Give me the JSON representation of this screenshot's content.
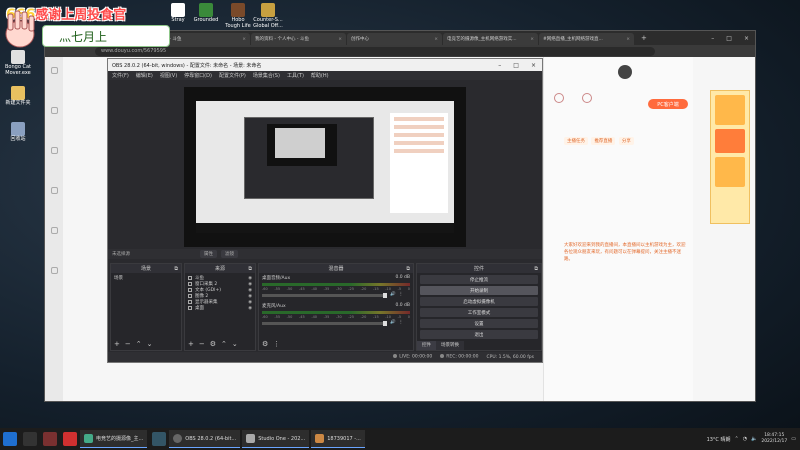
{
  "overlay": {
    "num": "666",
    "thanks": "感谢上周投食官",
    "name": "灬七月上"
  },
  "desktop_icons": [
    {
      "label": "Stray",
      "color": "#ffffff"
    },
    {
      "label": "Grounded",
      "color": "#3a8a3a"
    },
    {
      "label": "Hobo\nTough Life",
      "color": "#7a4a2a"
    },
    {
      "label": "Counter-S...\nGlobal Off...",
      "color": "#c8a040"
    }
  ],
  "left_icons": [
    {
      "label": "Bongo Cat\nMover.exe",
      "color": "#e0e0e0"
    },
    {
      "label": "新建文件夹",
      "color": "#e8c060"
    },
    {
      "label": "回收站",
      "color": "#8aa0c0"
    }
  ],
  "browser": {
    "tabs": [
      "关注 - 斗鱼",
      "我的资料 - 个人中心 - 斗鱼",
      "创作中心",
      "电竞艺的摄源像_主机网络游戏实...",
      "#网络直播_主机网络游戏直..."
    ],
    "address": "www.douyu.com/5679595",
    "side": [
      "",
      "",
      "",
      "",
      "",
      ""
    ]
  },
  "right_panel": {
    "pc_btn": "PC客户端",
    "tags": [
      "主播任务",
      "推荐直播",
      "分享"
    ],
    "text": "大家好欢迎来到我的直播间，本直播间以主机游戏为主，欢迎各位观众朋友来玩，有问题可以在弹幕提问，关注主播不迷路。"
  },
  "obs": {
    "title": "OBS 28.0.2 (64-bit, windows) - 配置文件: 未命名 - 场景: 未命名",
    "menu": [
      "文件(F)",
      "编辑(E)",
      "视图(V)",
      "停靠窗口(D)",
      "配置文件(P)",
      "场景集合(S)",
      "工具(T)",
      "帮助(H)"
    ],
    "scenebar": {
      "label": "未选择源",
      "btn1": "属性",
      "btn2": "滤镜"
    },
    "docks": {
      "scenes": {
        "title": "场景",
        "items": [
          "场景"
        ]
      },
      "sources": {
        "title": "来源",
        "items": [
          "斗鱼",
          "窗口采集 2",
          "文本 (GDI+)",
          "图像 2",
          "显示器采集",
          "桌面"
        ]
      },
      "mixer": {
        "title": "混音器",
        "channels": [
          {
            "name": "桌面音频/Aux",
            "db": "0.0 dB"
          },
          {
            "name": "麦克风/Aux",
            "db": "0.0 dB"
          }
        ],
        "scale": [
          "-60",
          "-55",
          "-50",
          "-45",
          "-40",
          "-35",
          "-30",
          "-25",
          "-20",
          "-15",
          "-10",
          "-5",
          "0"
        ]
      },
      "controls": {
        "title": "控件",
        "buttons": [
          "停止推流",
          "开始录制",
          "启动虚拟摄像机",
          "工作室模式",
          "设置",
          "退出"
        ],
        "tabs": [
          "控件",
          "场景转换"
        ]
      }
    },
    "status": {
      "live": "LIVE: 00:00:00",
      "rec": "REC: 00:00:00",
      "cpu": "CPU: 1.5%, 60.00 fps"
    }
  },
  "taskbar": {
    "apps": [
      "电竞艺的摄源像_主...",
      "OBS 28.0.2 (64-bit...",
      "Studio One - 202...",
      "18739017 -..."
    ],
    "weather": "13°C 晴朗",
    "time": "18:47:15",
    "date": "2022/12/17"
  }
}
